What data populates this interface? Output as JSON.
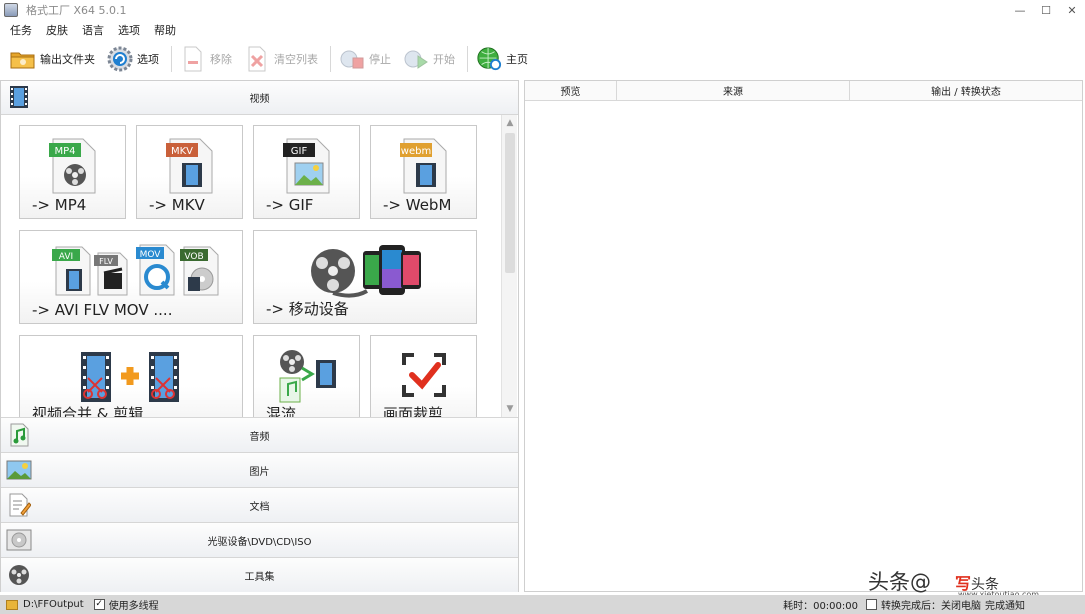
{
  "window": {
    "title": "格式工厂 X64 5.0.1",
    "controls": [
      "—",
      "☐",
      "✕"
    ]
  },
  "menu": [
    "任务",
    "皮肤",
    "语言",
    "选项",
    "帮助"
  ],
  "toolbar": {
    "output_folder": "输出文件夹",
    "options": "选项",
    "remove": "移除",
    "clear_list": "清空列表",
    "stop": "停止",
    "start": "开始",
    "home": "主页"
  },
  "categories": {
    "video": "视频",
    "audio": "音频",
    "image": "图片",
    "document": "文档",
    "optical": "光驱设备\\DVD\\CD\\ISO",
    "tools": "工具集"
  },
  "tiles": {
    "mp4": {
      "label": "-> MP4",
      "badge": "MP4"
    },
    "mkv": {
      "label": "-> MKV",
      "badge": "MKV"
    },
    "gif": {
      "label": "-> GIF",
      "badge": "GIF"
    },
    "webm": {
      "label": "-> WebM",
      "badge": "webm"
    },
    "multi": {
      "label": "-> AVI FLV MOV ....",
      "badges": [
        "AVI",
        "FLV",
        "MOV",
        "VOB"
      ]
    },
    "mobile": {
      "label": "-> 移动设备"
    },
    "merge": {
      "label": "视频合并 & 剪辑"
    },
    "mux": {
      "label": "混流"
    },
    "crop": {
      "label": "画面裁剪"
    }
  },
  "task_list": {
    "columns": [
      "预览",
      "来源",
      "输出 / 转换状态"
    ]
  },
  "status": {
    "output_path": "D:\\FFOutput",
    "multithread_label": "使用多线程",
    "multithread_checked": true,
    "elapsed": "耗时：00:00:00",
    "after_convert_label": "转换完成后：关闭电脑",
    "notify_label": "完成通知"
  },
  "watermark": {
    "text1": "头条@",
    "text2_red": "写",
    "text2_rest": "头条",
    "url": "www.xietoutiao.com"
  },
  "colors": {
    "accent_blue": "#1f7fd0",
    "green": "#3fae3f",
    "red": "#e0301e",
    "status_bar": "#d7d7d7"
  }
}
